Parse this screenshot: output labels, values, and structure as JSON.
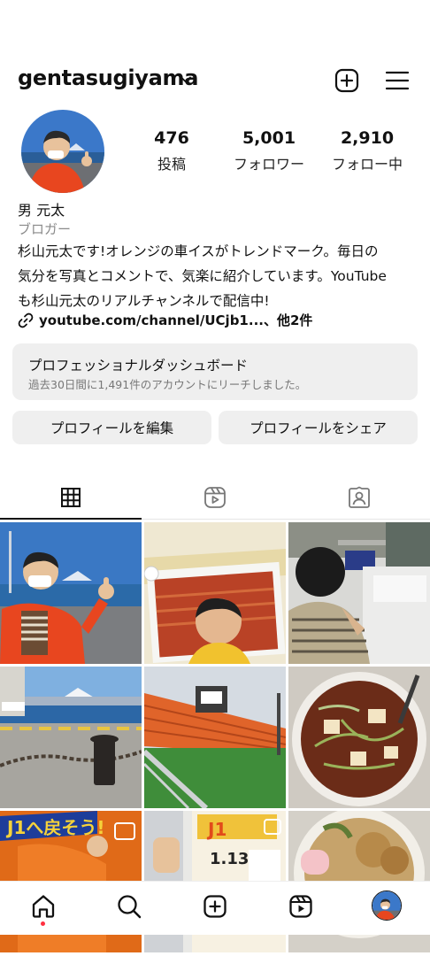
{
  "header": {
    "username": "gentasugiyama"
  },
  "profile": {
    "stats": [
      {
        "value": "476",
        "label": "投稿"
      },
      {
        "value": "5,001",
        "label": "フォロワー"
      },
      {
        "value": "2,910",
        "label": "フォロー中"
      }
    ],
    "name": "男 元太",
    "category": "ブロガー",
    "bio_lines": [
      "杉山元太です!オレンジの車イスがトレンドマーク。毎日の",
      "気分を写真とコメントで、気楽に紹介しています。YouTube",
      "も杉山元太のリアルチャンネルで配信中!"
    ],
    "link": "youtube.com/channel/UCjb1...、他2件"
  },
  "dashboard": {
    "title": "プロフェッショナルダッシュボード",
    "subtitle": "過去30日間に1,491件のアカウントにリーチしました。"
  },
  "buttons": {
    "edit": "プロフィールを編集",
    "share": "プロフィールをシェア"
  },
  "tabs": [
    "grid-icon",
    "reels-icon",
    "tagged-icon"
  ],
  "grid_overlay_text": {
    "tile1_banner": "J1へ戻そう!",
    "tile2_date": "1.13",
    "tile2_banner": "J1"
  },
  "nav": [
    "home-icon",
    "search-icon",
    "create-icon",
    "reels-icon",
    "profile-avatar"
  ],
  "colors": {
    "accent_dot": "#ff3040",
    "orange": "#e8641c"
  }
}
